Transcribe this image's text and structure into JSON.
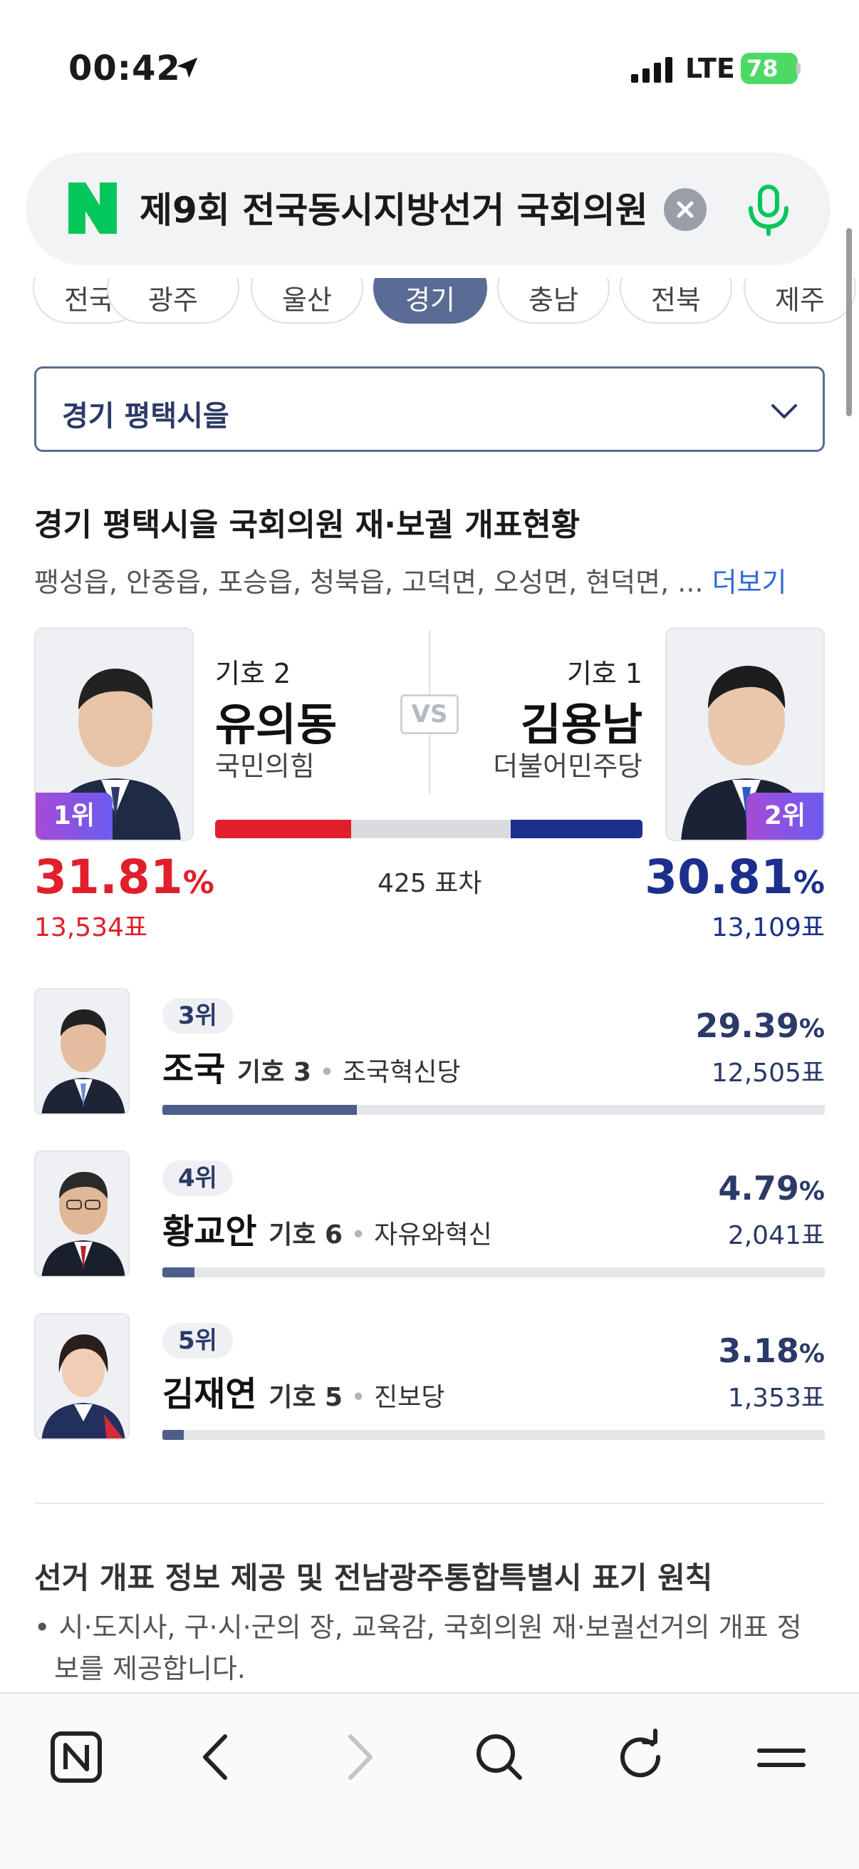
{
  "status_bar": {
    "time": "00:42",
    "network": "LTE",
    "battery": "78"
  },
  "search": {
    "query": "제9회 전국동시지방선거 국회의원"
  },
  "region_chips": [
    "전국",
    "광주",
    "울산",
    "경기",
    "충남",
    "전북",
    "제주"
  ],
  "region_select": {
    "value": "경기 평택시을"
  },
  "section": {
    "title": "경기 평택시을 국회의원 재·보궐 개표현황",
    "districts": "팽성읍, 안중읍, 포승읍, 청북읍, 고덕면, 오성면, 현덕면,  ...",
    "more": "더보기"
  },
  "head_to_head": {
    "vs": "VS",
    "gap": "425 표차",
    "left": {
      "rank": "1위",
      "number": "기호 2",
      "name": "유의동",
      "party": "국민의힘",
      "pct": "31.81",
      "pct_unit": "%",
      "votes": "13,534표",
      "color": "#e11f2c"
    },
    "right": {
      "rank": "2위",
      "number": "기호 1",
      "name": "김용남",
      "party": "더불어민주당",
      "pct": "30.81",
      "pct_unit": "%",
      "votes": "13,109표",
      "color": "#1c2f8c"
    },
    "bar_share": {
      "left": 0.3181,
      "right": 0.3081
    }
  },
  "others": [
    {
      "rank": "3위",
      "name": "조국",
      "number": "기호 3",
      "party": "조국혁신당",
      "pct": "29.39",
      "pct_unit": "%",
      "votes": "12,505표",
      "share": 0.2939
    },
    {
      "rank": "4위",
      "name": "황교안",
      "number": "기호 6",
      "party": "자유와혁신",
      "pct": "4.79",
      "pct_unit": "%",
      "votes": "2,041표",
      "share": 0.0479
    },
    {
      "rank": "5위",
      "name": "김재연",
      "number": "기호 5",
      "party": "진보당",
      "pct": "3.18",
      "pct_unit": "%",
      "votes": "1,353표",
      "share": 0.0318
    }
  ],
  "notice": {
    "title": "선거 개표 정보 제공 및 전남광주통합특별시 표기 원칙",
    "body": "• 시·도지사, 구·시·군의 장, 교육감, 국회의원 재·보궐선거의 개표 정보를 제공합니다."
  },
  "colors": {
    "accent": "#5a6c96",
    "naver_green": "#03c75a",
    "rank_badge_left": "#a64bd6",
    "rank_badge_right": "#6a5cf0"
  },
  "icons": {
    "search_left": "naver-n-icon",
    "clear": "clear-icon",
    "mic": "mic-icon",
    "toolbar": [
      "naver-home-icon",
      "back-icon",
      "forward-icon",
      "search-icon",
      "reload-icon",
      "menu-icon"
    ]
  }
}
